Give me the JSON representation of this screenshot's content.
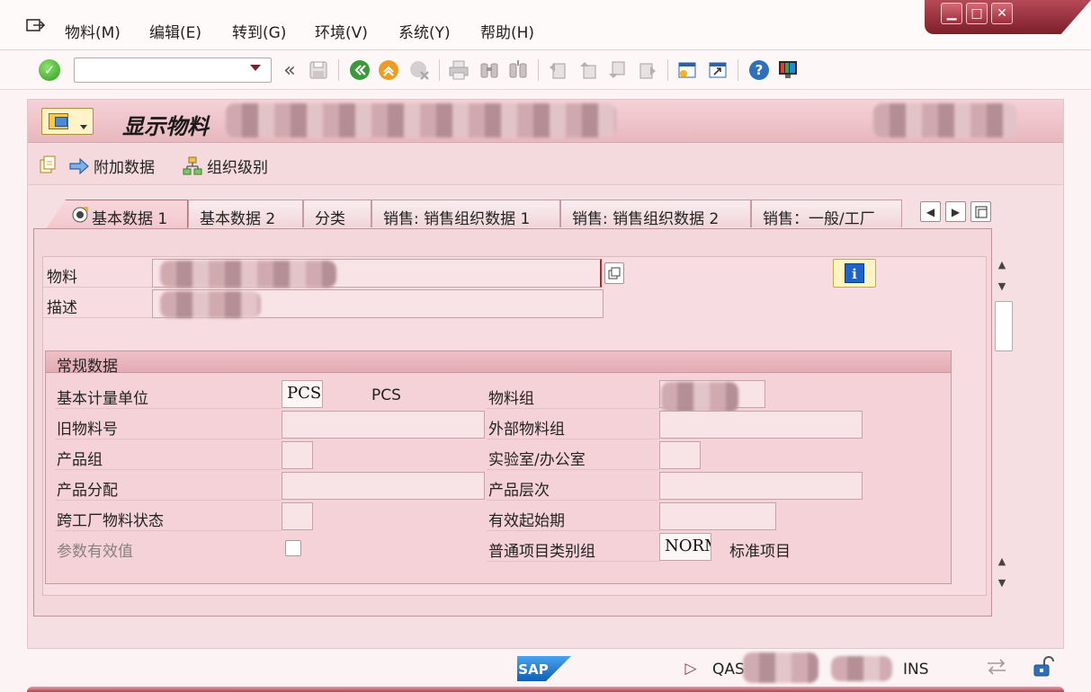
{
  "menu": {
    "items": [
      {
        "label": "物料(M)"
      },
      {
        "label": "编辑(E)"
      },
      {
        "label": "转到(G)"
      },
      {
        "label": "环境(V)"
      },
      {
        "label": "系统(Y)"
      },
      {
        "label": "帮助(H)"
      }
    ]
  },
  "window_controls": {
    "minimize": "▁",
    "maximize": "□",
    "close": "✕"
  },
  "toolbar": {
    "command_field_value": "",
    "back_glyph": "«"
  },
  "title": {
    "text": "显示物料"
  },
  "app_toolbar": {
    "additional_data_label": "附加数据",
    "org_levels_label": "组织级别"
  },
  "tabs": [
    {
      "label": "基本数据 1",
      "active": true
    },
    {
      "label": "基本数据 2",
      "active": false
    },
    {
      "label": "分类",
      "active": false
    },
    {
      "label": "销售: 销售组织数据 1",
      "active": false
    },
    {
      "label": "销售: 销售组织数据 2",
      "active": false
    },
    {
      "label": "销售：一般/工厂",
      "active": false
    }
  ],
  "header_fields": {
    "material_label": "物料",
    "material_value": "",
    "description_label": "描述",
    "description_value": ""
  },
  "general_data": {
    "title": "常规数据",
    "base_uom_label": "基本计量单位",
    "base_uom_value": "PCS",
    "base_uom_text": "PCS",
    "old_material_label": "旧物料号",
    "old_material_value": "",
    "division_label": "产品组",
    "division_value": "",
    "product_allocation_label": "产品分配",
    "product_allocation_value": "",
    "cross_plant_status_label": "跨工厂物料状态",
    "cross_plant_status_value": "",
    "parameter_effectivity_label": "参数有效值",
    "material_group_label": "物料组",
    "material_group_value": "",
    "external_material_group_label": "外部物料组",
    "external_material_group_value": "",
    "lab_office_label": "实验室/办公室",
    "lab_office_value": "",
    "product_hierarchy_label": "产品层次",
    "product_hierarchy_value": "",
    "valid_from_label": "有效起始期",
    "valid_from_value": "",
    "item_category_group_label": "普通项目类别组",
    "item_category_group_value": "NORM",
    "item_category_group_text": "标准项目"
  },
  "status_bar": {
    "sap_logo": "SAP",
    "system": "QAS",
    "mode": "INS"
  },
  "colors": {
    "accent": "#b54a56",
    "background": "#f6dfe2"
  }
}
